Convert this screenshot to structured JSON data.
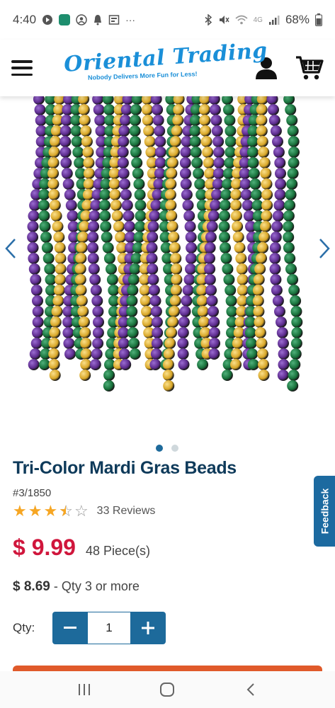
{
  "status_bar": {
    "time": "4:40",
    "battery": "68%",
    "left_icons": [
      "play-icon",
      "calendar-icon",
      "account-icon",
      "notification-icon",
      "news-icon",
      "more-icon"
    ],
    "right_icons": [
      "bluetooth-icon",
      "mute-icon",
      "wifi-icon",
      "signal-icon",
      "battery-icon"
    ],
    "more": "···",
    "network": "4G"
  },
  "header": {
    "logo_text": "Oriental Trading",
    "logo_tagline": "Nobody Delivers More Fun for Less!",
    "brand_color": "#1a8fd8"
  },
  "product": {
    "image_alt": "Mardi Gras bead necklaces in purple, green and gold",
    "bead_colors": [
      "#5b2a8c",
      "#17703a",
      "#d7a526"
    ],
    "carousel": {
      "count": 2,
      "active_index": 0
    },
    "title": "Tri-Color Mardi Gras Beads",
    "sku": "#3/1850",
    "rating": 3.5,
    "rating_max": 5,
    "reviews_label": "33 Reviews",
    "price": "$ 9.99",
    "pieces": "48 Piece(s)",
    "bulk_price": "$ 8.69",
    "bulk_note": " - Qty 3 or more",
    "qty_label": "Qty:",
    "qty_value": "1",
    "price_color": "#d0163c",
    "accent_color": "#1d6a9b"
  },
  "feedback_label": "Feedback",
  "nav_bar": {
    "recents": "recents-icon",
    "home": "home-icon",
    "back": "back-icon"
  }
}
